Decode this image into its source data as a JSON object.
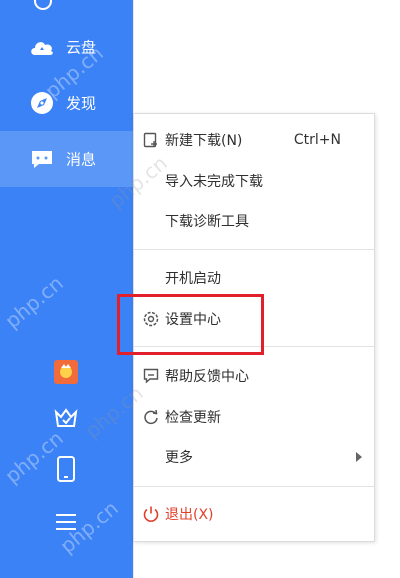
{
  "sidebar": {
    "items": [
      {
        "label": "云盘",
        "icon": "cloud-icon"
      },
      {
        "label": "发现",
        "icon": "compass-icon"
      },
      {
        "label": "消息",
        "icon": "message-icon"
      }
    ],
    "bottom_icons": [
      "gift-icon",
      "crown-icon",
      "phone-icon",
      "menu-icon"
    ],
    "color": "#3b82f6",
    "active_color": "#5a97f7"
  },
  "menu": {
    "new_download": {
      "label": "新建下载(N)",
      "shortcut": "Ctrl+N"
    },
    "import_unfinished": "导入未完成下载",
    "diagnose_tool": "下载诊断工具",
    "autostart": "开机启动",
    "settings": "设置中心",
    "help_feedback": "帮助反馈中心",
    "check_update": "检查更新",
    "more": "更多",
    "exit": "退出(X)",
    "exit_color": "#e0402a"
  },
  "watermark": "php.cn",
  "highlight_color": "#e0202a"
}
